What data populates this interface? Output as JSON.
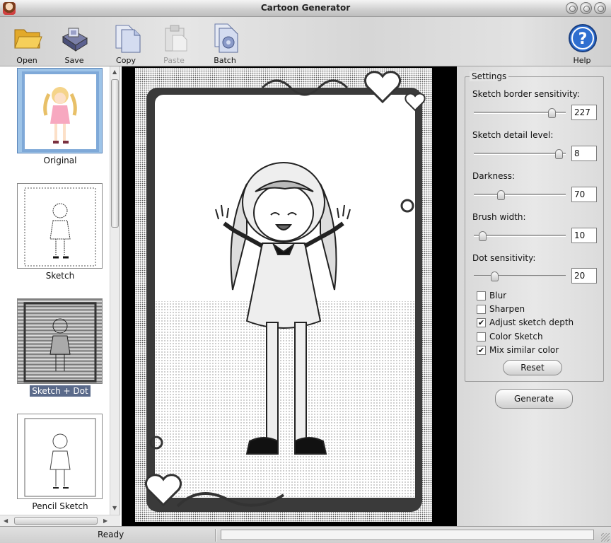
{
  "window": {
    "title": "Cartoon Generator"
  },
  "toolbar": {
    "items": [
      {
        "label": "Open",
        "icon": "folder-icon",
        "enabled": true
      },
      {
        "label": "Save",
        "icon": "floppy-disk-icon",
        "enabled": true
      },
      {
        "label": "Copy",
        "icon": "copy-icon",
        "enabled": true
      },
      {
        "label": "Paste",
        "icon": "clipboard-icon",
        "enabled": false
      },
      {
        "label": "Batch",
        "icon": "gear-document-icon",
        "enabled": true
      }
    ],
    "help_label": "Help"
  },
  "thumbnails": [
    {
      "label": "Original",
      "selected": false
    },
    {
      "label": "Sketch",
      "selected": false
    },
    {
      "label": "Sketch + Dot",
      "selected": true
    },
    {
      "label": "Pencil Sketch",
      "selected": false
    }
  ],
  "settings": {
    "group_title": "Settings",
    "sliders": [
      {
        "label": "Sketch border sensitivity:",
        "value": "227",
        "level": 0.88
      },
      {
        "label": "Sketch detail level:",
        "value": "8",
        "level": 0.97
      },
      {
        "label": "Darkness:",
        "value": "70",
        "level": 0.28
      },
      {
        "label": "Brush width:",
        "value": "10",
        "level": 0.06
      },
      {
        "label": "Dot sensitivity:",
        "value": "20",
        "level": 0.2
      }
    ],
    "checkboxes": [
      {
        "label": "Blur",
        "checked": false
      },
      {
        "label": "Sharpen",
        "checked": false
      },
      {
        "label": "Adjust sketch depth",
        "checked": true
      },
      {
        "label": "Color Sketch",
        "checked": false
      },
      {
        "label": "Mix similar color",
        "checked": true
      }
    ],
    "reset_label": "Reset",
    "generate_label": "Generate"
  },
  "status": {
    "text": "Ready"
  },
  "colors": {
    "selection": "#5a6a8a",
    "help_blue": "#2f6fd0",
    "folder": "#f0c040"
  }
}
